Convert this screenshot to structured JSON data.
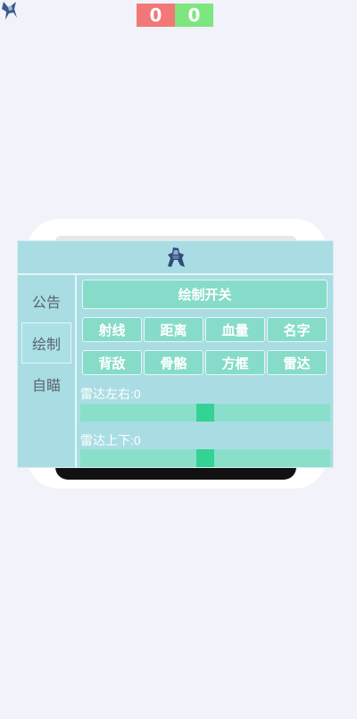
{
  "score": {
    "left": "0",
    "right": "0"
  },
  "menu": {
    "sidebar": [
      {
        "label": "公告"
      },
      {
        "label": "绘制"
      },
      {
        "label": "自瞄"
      }
    ],
    "draw_toggle_label": "绘制开关",
    "buttons_row1": [
      "射线",
      "距离",
      "血量",
      "名字"
    ],
    "buttons_row2": [
      "背敌",
      "骨骼",
      "方框",
      "雷达"
    ],
    "sliders": [
      {
        "label": "雷达左右:0",
        "value": 0.5
      },
      {
        "label": "雷达上下:0",
        "value": 0.5
      }
    ]
  },
  "colors": {
    "score_left": "#f27777",
    "score_right": "#7ee67e",
    "panel": "#a9dde3",
    "button": "#86dcc8",
    "slider_thumb": "#34d294"
  }
}
